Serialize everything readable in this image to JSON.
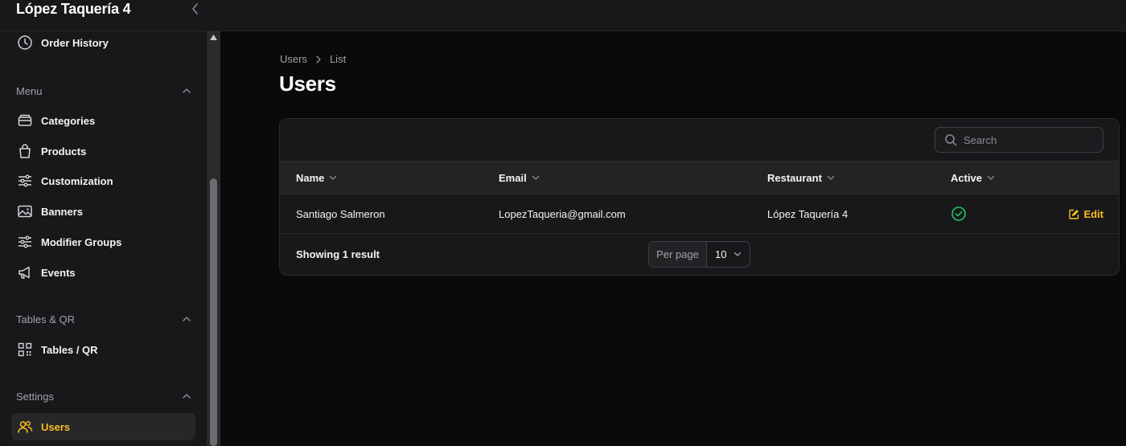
{
  "app": {
    "brand": "López Taquería 4"
  },
  "sidebar": {
    "top_items": [
      {
        "label": "Order History",
        "icon": "clock-icon"
      }
    ],
    "groups": [
      {
        "label": "Menu",
        "items": [
          {
            "label": "Categories",
            "icon": "box-icon"
          },
          {
            "label": "Products",
            "icon": "shopping-bag-icon"
          },
          {
            "label": "Customization",
            "icon": "sliders-icon"
          },
          {
            "label": "Banners",
            "icon": "image-icon"
          },
          {
            "label": "Modifier Groups",
            "icon": "sliders-icon"
          },
          {
            "label": "Events",
            "icon": "megaphone-icon"
          }
        ]
      },
      {
        "label": "Tables & QR",
        "items": [
          {
            "label": "Tables / QR",
            "icon": "qr-code-icon"
          }
        ]
      },
      {
        "label": "Settings",
        "items": [
          {
            "label": "Users",
            "icon": "users-icon",
            "active": true
          }
        ]
      }
    ]
  },
  "breadcrumb": [
    "Users",
    "List"
  ],
  "page_title": "Users",
  "table": {
    "search_placeholder": "Search",
    "columns": [
      "Name",
      "Email",
      "Restaurant",
      "Active"
    ],
    "rows": [
      {
        "name": "Santiago Salmeron",
        "email": "LopezTaqueria@gmail.com",
        "restaurant": "López Taquería 4",
        "active": true,
        "action": "Edit"
      }
    ],
    "result_text": "Showing 1 result",
    "per_page_label": "Per page",
    "per_page_value": "10"
  },
  "colors": {
    "accent": "#fbbf24",
    "success": "#22c55e",
    "background": "#0a0a0b",
    "surface": "#18181b"
  }
}
